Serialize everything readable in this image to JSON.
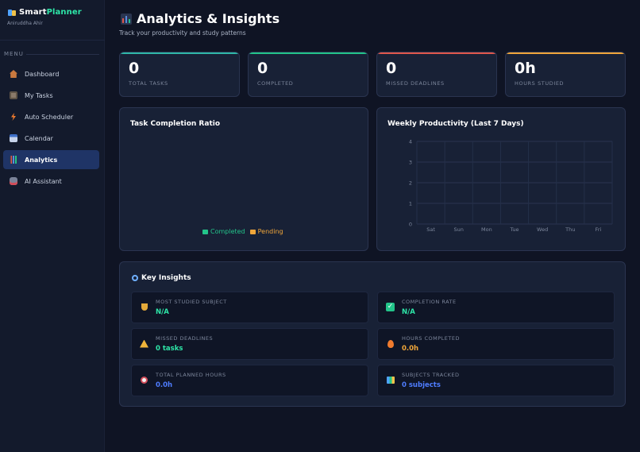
{
  "sidebar": {
    "brand": {
      "name_part1": "Smart",
      "name_part2": "Planner"
    },
    "user_name": "Aniruddha Ahir",
    "menu_label": "MENU",
    "items": [
      {
        "label": "Dashboard",
        "icon": "house-icon",
        "icon_color": "#e2874a"
      },
      {
        "label": "My Tasks",
        "icon": "clipboard-icon",
        "icon_color": "#8a7a6a"
      },
      {
        "label": "Auto Scheduler",
        "icon": "lightning-icon",
        "icon_color": "#f07b2e"
      },
      {
        "label": "Calendar",
        "icon": "calendar-icon",
        "icon_color": "#3f70c8"
      },
      {
        "label": "Analytics",
        "icon": "bar-chart-icon",
        "icon_color": "#5a8be0",
        "active": true
      },
      {
        "label": "AI Assistant",
        "icon": "robot-icon",
        "icon_color": "#7a8298"
      }
    ]
  },
  "header": {
    "title": "Analytics & Insights",
    "subtitle": "Track your productivity and study patterns"
  },
  "stats": [
    {
      "value": "0",
      "label": "TOTAL TASKS",
      "accent": "#2fb7a8"
    },
    {
      "value": "0",
      "label": "COMPLETED",
      "accent": "#23c48a"
    },
    {
      "value": "0",
      "label": "MISSED DEADLINES",
      "accent": "#e0574c"
    },
    {
      "value": "0h",
      "label": "HOURS STUDIED",
      "accent": "#f0a63a"
    }
  ],
  "completion_panel": {
    "title": "Task Completion Ratio",
    "legend": [
      {
        "label": "Completed",
        "color": "#23c48a"
      },
      {
        "label": "Pending",
        "color": "#f0a63a"
      }
    ]
  },
  "productivity_panel": {
    "title": "Weekly Productivity (Last 7 Days)"
  },
  "chart_data": {
    "type": "bar",
    "title": "Weekly Productivity (Last 7 Days)",
    "categories": [
      "Sat",
      "Sun",
      "Mon",
      "Tue",
      "Wed",
      "Thu",
      "Fri"
    ],
    "values": [
      0,
      0,
      0,
      0,
      0,
      0,
      0
    ],
    "yticks": [
      "0",
      "1",
      "2",
      "3",
      "4"
    ],
    "ylim": [
      0,
      4
    ],
    "grid": true
  },
  "insights": {
    "title": "Key Insights",
    "items": [
      {
        "label": "MOST STUDIED SUBJECT",
        "value": "N/A",
        "value_color": "#2ee6a8",
        "icon": "trophy-icon"
      },
      {
        "label": "COMPLETION RATE",
        "value": "N/A",
        "value_color": "#2ee6a8",
        "icon": "check-icon"
      },
      {
        "label": "MISSED DEADLINES",
        "value": "0 tasks",
        "value_color": "#2ee6a8",
        "icon": "warning-icon"
      },
      {
        "label": "HOURS COMPLETED",
        "value": "0.0h",
        "value_color": "#f0a63a",
        "icon": "fire-icon"
      },
      {
        "label": "TOTAL PLANNED HOURS",
        "value": "0.0h",
        "value_color": "#4f7dff",
        "icon": "alarm-clock-icon"
      },
      {
        "label": "SUBJECTS TRACKED",
        "value": "0 subjects",
        "value_color": "#4f7dff",
        "icon": "books-icon"
      }
    ]
  }
}
